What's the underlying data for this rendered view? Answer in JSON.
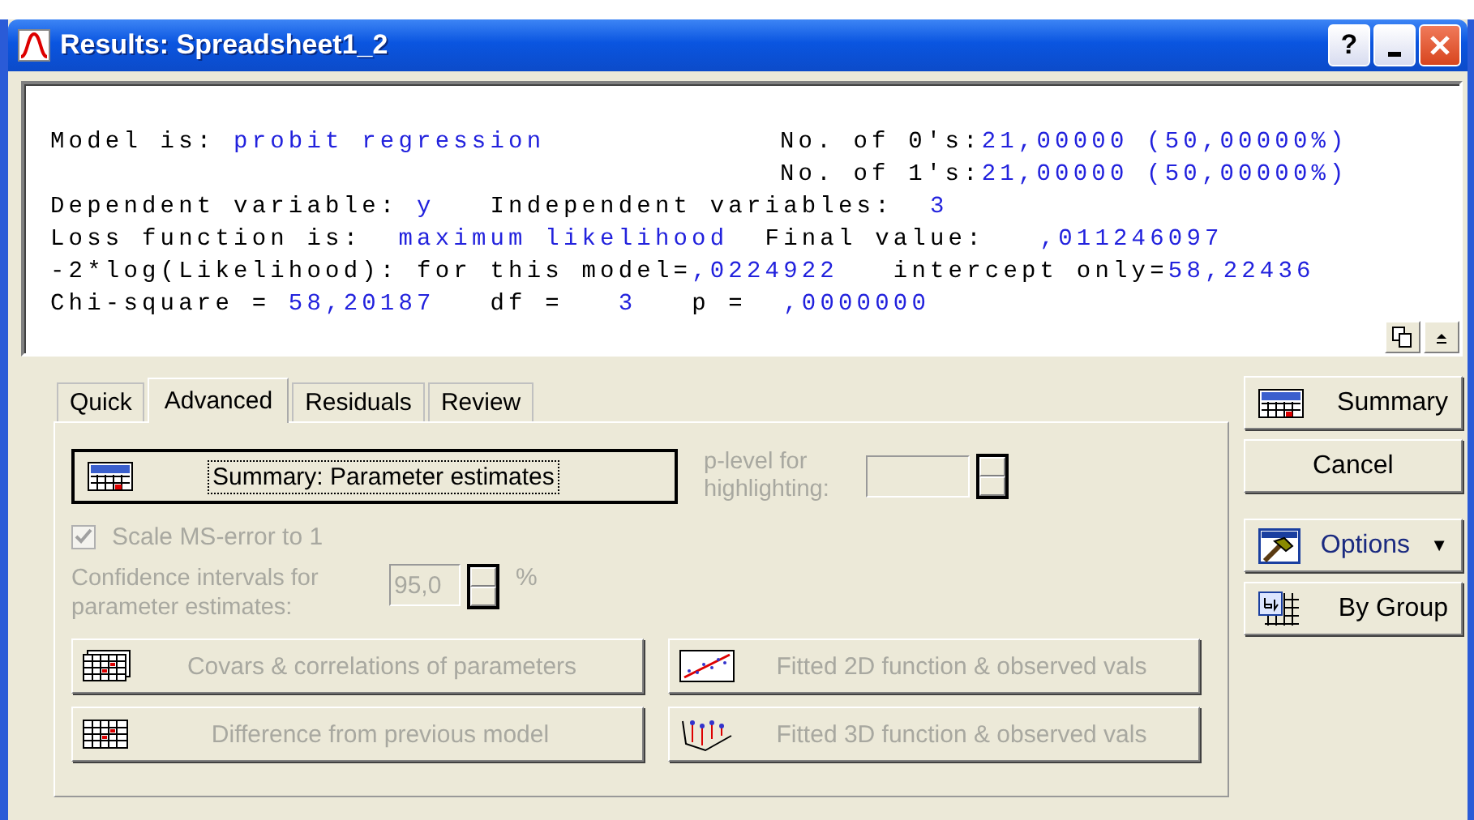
{
  "window": {
    "title": "Results: Spreadsheet1_2",
    "help_button": "?"
  },
  "output": {
    "lines": [
      {
        "left": [
          {
            "text": "Model is: ",
            "kind": "label"
          },
          {
            "text": "probit regression",
            "kind": "value"
          }
        ],
        "right": [
          {
            "text": "No. of 0's:",
            "kind": "label"
          },
          {
            "text": "21,00000 (50,00000%)",
            "kind": "value"
          }
        ]
      },
      {
        "right": [
          {
            "text": "No. of 1's:",
            "kind": "label"
          },
          {
            "text": "21,00000 (50,00000%)",
            "kind": "value"
          }
        ]
      },
      {
        "left": [
          {
            "text": "Dependent variable: ",
            "kind": "label"
          },
          {
            "text": "y",
            "kind": "value"
          },
          {
            "text": "   Independent variables:  ",
            "kind": "label"
          },
          {
            "text": "3",
            "kind": "value"
          }
        ]
      },
      {
        "left": [
          {
            "text": "Loss function is:  ",
            "kind": "label"
          },
          {
            "text": "maximum likelihood",
            "kind": "value"
          },
          {
            "text": "  Final value:   ",
            "kind": "label"
          },
          {
            "text": ",011246097",
            "kind": "value"
          }
        ]
      },
      {
        "left": [
          {
            "text": "-2*log(Likelihood): for this model=",
            "kind": "label"
          },
          {
            "text": ",0224922",
            "kind": "value"
          },
          {
            "text": "   intercept only=",
            "kind": "label"
          },
          {
            "text": "58,22436",
            "kind": "value"
          }
        ]
      },
      {
        "left": [
          {
            "text": "Chi-square = ",
            "kind": "label"
          },
          {
            "text": "58,20187",
            "kind": "value"
          },
          {
            "text": "   df =   ",
            "kind": "label"
          },
          {
            "text": "3",
            "kind": "value"
          },
          {
            "text": "   p =  ",
            "kind": "label"
          },
          {
            "text": ",0000000",
            "kind": "value"
          }
        ]
      }
    ]
  },
  "tabs": [
    {
      "label": "Quick",
      "selected": false
    },
    {
      "label": "Advanced",
      "selected": true
    },
    {
      "label": "Residuals",
      "selected": false
    },
    {
      "label": "Review",
      "selected": false
    }
  ],
  "summary_button": {
    "label": "Summary: Parameter estimates"
  },
  "p_level": {
    "label": "p-level for highlighting:",
    "disabled": true
  },
  "scale_checkbox": {
    "label": "Scale MS-error to 1",
    "checked": true,
    "disabled": true
  },
  "confidence": {
    "label": "Confidence intervals for parameter estimates:",
    "value": "95,0",
    "unit": "%",
    "disabled": true
  },
  "action_buttons": [
    {
      "label": "Covars & correlations of parameters",
      "disabled": true
    },
    {
      "label": "Fitted 2D function & observed vals",
      "disabled": true
    },
    {
      "label": "Difference from previous model",
      "disabled": true
    },
    {
      "label": "Fitted 3D function & observed vals",
      "disabled": true
    }
  ],
  "side_buttons": [
    {
      "label": "Summary"
    },
    {
      "label": "Cancel"
    },
    {
      "label": "Options",
      "caret": "▼"
    },
    {
      "label": "By Group"
    }
  ]
}
